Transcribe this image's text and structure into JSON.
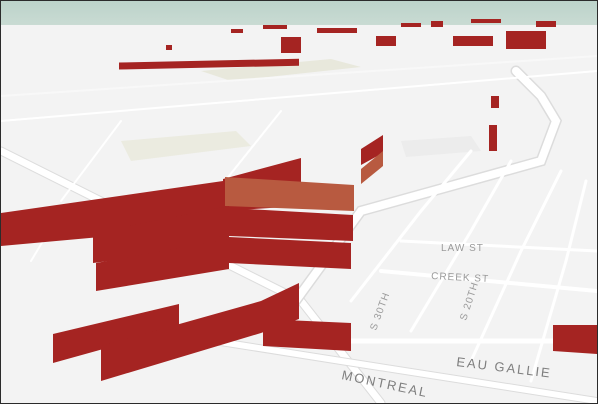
{
  "map": {
    "style": "3D perspective street map",
    "colors": {
      "ground": "#f3f3f3",
      "road": "#ffffff",
      "road_edge": "#d6d6d6",
      "park": "#e8e8dc",
      "extrusion": "#a52422",
      "extrusion_highlight": "#b85a40",
      "sky": "#c2d7cf"
    }
  },
  "labels": {
    "eau_gallie": "EAU GALLIE",
    "montreal": "MONTREAL",
    "creek_st": "CREEK ST",
    "law_st": "LAW ST",
    "street_a": "S 30TH",
    "street_b": "S 20TH"
  }
}
